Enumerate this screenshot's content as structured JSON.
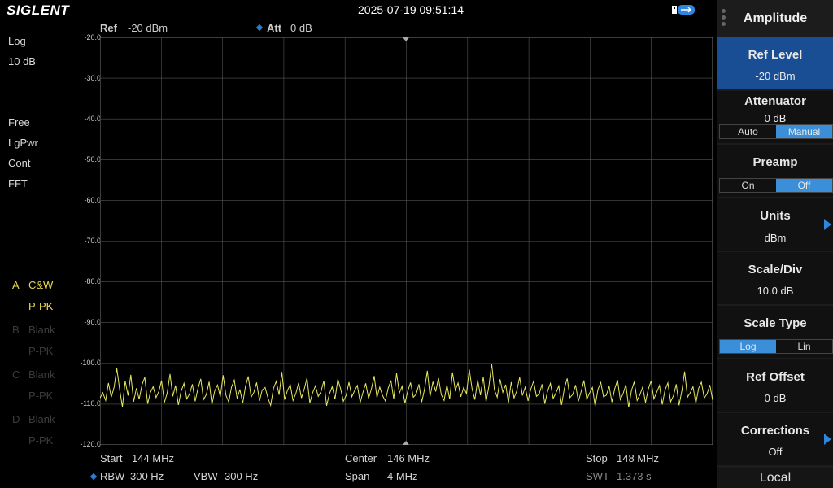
{
  "header": {
    "brand": "SIGLENT",
    "datetime": "2025-07-19 09:51:14",
    "usb_icon": "usb-icon"
  },
  "left_panel": {
    "scale_mode": "Log",
    "scale_div": "10 dB",
    "trigger": "Free",
    "detector": "LgPwr",
    "sweep_mode": "Cont",
    "sweep_type": "FFT",
    "traces": [
      {
        "letter": "A",
        "mode": "C&W",
        "detect": "P-PK"
      },
      {
        "letter": "B",
        "mode": "Blank",
        "detect": "P-PK"
      },
      {
        "letter": "C",
        "mode": "Blank",
        "detect": "P-PK"
      },
      {
        "letter": "D",
        "mode": "Blank",
        "detect": "P-PK"
      }
    ]
  },
  "plot_header": {
    "ref_label": "Ref",
    "ref_value": "-20 dBm",
    "att_label": "Att",
    "att_value": "0 dB"
  },
  "y_axis": {
    "ticks": [
      "-20.0",
      "-30.0",
      "-40.0",
      "-50.0",
      "-60.0",
      "-70.0",
      "-80.0",
      "-90.0",
      "-100.0",
      "-110.0",
      "-120.0"
    ]
  },
  "bottom": {
    "start_label": "Start",
    "start_value": "144 MHz",
    "center_label": "Center",
    "center_value": "146 MHz",
    "stop_label": "Stop",
    "stop_value": "148 MHz",
    "rbw_label": "RBW",
    "rbw_value": "300 Hz",
    "vbw_label": "VBW",
    "vbw_value": "300 Hz",
    "span_label": "Span",
    "span_value": "4 MHz",
    "swt_label": "SWT",
    "swt_value": "1.373 s"
  },
  "menu": {
    "title": "Amplitude",
    "ref_level": {
      "label": "Ref Level",
      "value": "-20 dBm"
    },
    "attenuator": {
      "label": "Attenuator",
      "value": "0 dB",
      "options": [
        "Auto",
        "Manual"
      ],
      "selected": "Manual"
    },
    "preamp": {
      "label": "Preamp",
      "options": [
        "On",
        "Off"
      ],
      "selected": "Off"
    },
    "units": {
      "label": "Units",
      "value": "dBm"
    },
    "scale_div": {
      "label": "Scale/Div",
      "value": "10.0 dB"
    },
    "scale_type": {
      "label": "Scale Type",
      "options": [
        "Log",
        "Lin"
      ],
      "selected": "Log"
    },
    "ref_offset": {
      "label": "Ref Offset",
      "value": "0 dB"
    },
    "corrections": {
      "label": "Corrections",
      "value": "Off"
    },
    "local": "Local"
  },
  "colors": {
    "trace": "#e8e860",
    "accent": "#3a8fd8",
    "selected_item": "#1a4e94",
    "grid": "#555555"
  },
  "chart_data": {
    "type": "line",
    "x_range": [
      144,
      148
    ],
    "ylim": [
      -120,
      -20
    ],
    "grid": true,
    "series": [
      {
        "values": [
          -108.5,
          -107.2,
          -109.1,
          -104.8,
          -108.3,
          -105.9,
          -101.2,
          -106.4,
          -110.7,
          -104.3,
          -107.9,
          -102.8,
          -109.4,
          -106.1,
          -108.8,
          -105.2,
          -103.4,
          -109.9,
          -107.1,
          -105.7,
          -108.4,
          -106.9,
          -104.2,
          -109.6,
          -107.3,
          -102.6,
          -108.1,
          -105.4,
          -110.2,
          -106.8,
          -104.9,
          -108.7,
          -107.5,
          -105.1,
          -109.3,
          -106.2,
          -103.8,
          -108.9,
          -107.6,
          -104.5,
          -110.1,
          -106.7,
          -105.3,
          -108.2,
          -102.9,
          -107.8,
          -109.5,
          -105.8,
          -104.1,
          -108.6,
          -106.4,
          -109.8,
          -105.6,
          -103.2,
          -108.3,
          -107.1,
          -104.7,
          -109.2,
          -106.5,
          -105.9,
          -108.4,
          -110.3,
          -106.1,
          -104.4,
          -107.7,
          -102.1,
          -108.9,
          -106.6,
          -105.2,
          -109.1,
          -107.4,
          -104.8,
          -108.5,
          -106.3,
          -103.6,
          -109.7,
          -107.2,
          -105.5,
          -108.1,
          -106.9,
          -104.3,
          -110.4,
          -107.5,
          -105.7,
          -108.8,
          -103.9,
          -106.2,
          -109.3,
          -107.8,
          -104.6,
          -108.2,
          -106.7,
          -105.4,
          -109.6,
          -107.1,
          -104.9,
          -108.6,
          -106.3,
          -103.1,
          -108.4,
          -105.8,
          -107.9,
          -109.2,
          -106.1,
          -104.2,
          -108.7,
          -102.4,
          -107.3,
          -105.6,
          -109.8,
          -106.8,
          -104.7,
          -108.3,
          -107.6,
          -105.1,
          -109.5,
          -106.4,
          -101.8,
          -108.1,
          -104.5,
          -106.9,
          -103.6,
          -107.7,
          -109.1,
          -105.3,
          -108.8,
          -102.2,
          -106.6,
          -104.8,
          -108.2,
          -105.9,
          -107.4,
          -101.5,
          -106.2,
          -108.9,
          -104.1,
          -107.8,
          -103.3,
          -109.4,
          -105.7,
          -100.1,
          -106.5,
          -108.3,
          -103.9,
          -107.1,
          -105.2,
          -109.7,
          -104.6,
          -108.5,
          -106.7,
          -103.4,
          -107.9,
          -105.8,
          -109.2,
          -106.3,
          -104.4,
          -108.1,
          -107.5,
          -105.1,
          -109.9,
          -106.8,
          -104.9,
          -108.6,
          -107.2,
          -105.5,
          -110.2,
          -106.1,
          -103.7,
          -108.4,
          -107.6,
          -105.3,
          -109.3,
          -106.9,
          -104.2,
          -108.8,
          -107.3,
          -105.9,
          -110.5,
          -106.4,
          -104.7,
          -108.2,
          -107.8,
          -105.6,
          -109.5,
          -106.2,
          -104.1,
          -108.9,
          -107.4,
          -105.2,
          -110.8,
          -106.6,
          -104.5,
          -109.1,
          -107.7,
          -105.8,
          -109.6,
          -106.3,
          -104.3,
          -108.7,
          -107.1,
          -105.4,
          -110.1,
          -106.5,
          -104.8,
          -109.4,
          -107.9,
          -105.1,
          -110.3,
          -106.7,
          -102.0,
          -108.3,
          -107.2,
          -105.7,
          -109.8,
          -106.1,
          -104.6,
          -108.5,
          -107.5,
          -105.3,
          -109.0
        ]
      }
    ]
  }
}
